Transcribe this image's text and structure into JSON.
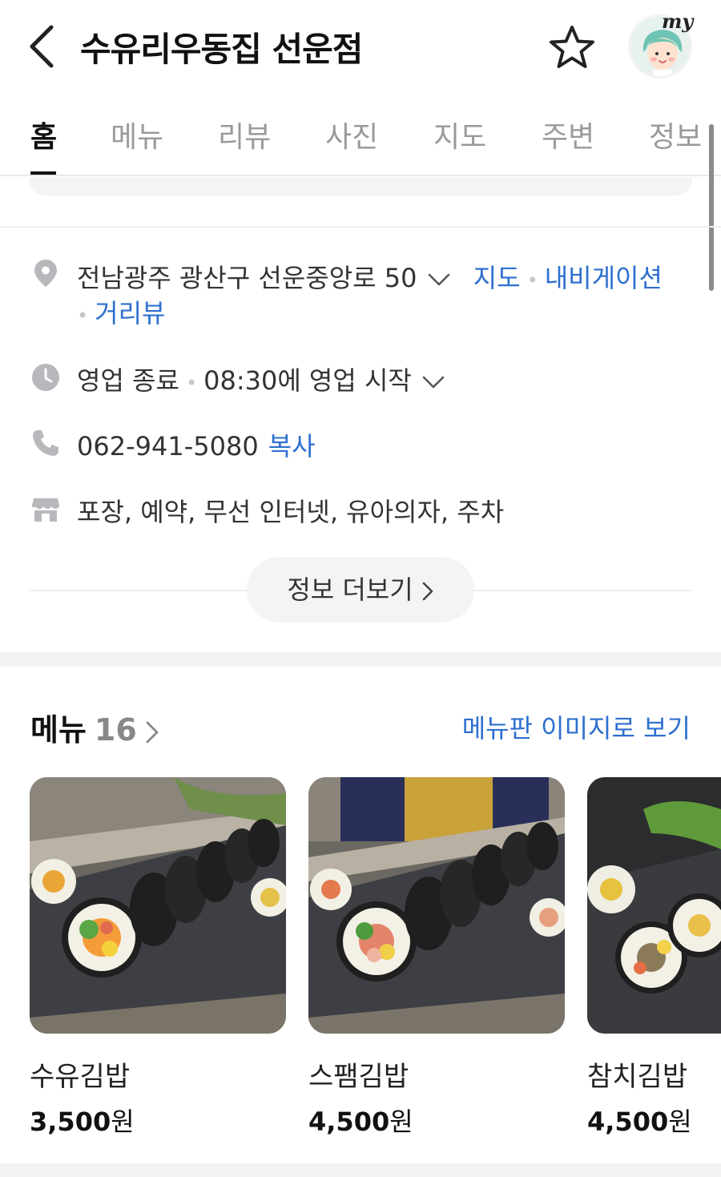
{
  "header": {
    "title": "수유리우동집 선운점",
    "avatar_badge": "my"
  },
  "tabs": [
    {
      "label": "홈",
      "active": true
    },
    {
      "label": "메뉴"
    },
    {
      "label": "리뷰"
    },
    {
      "label": "사진"
    },
    {
      "label": "지도"
    },
    {
      "label": "주변"
    },
    {
      "label": "정보"
    }
  ],
  "info": {
    "address": "전남광주 광산구 선운중앙로 50",
    "map_link": "지도",
    "navigation_link": "내비게이션",
    "streetview_link": "거리뷰",
    "hours_status": "영업 종료",
    "hours_next": "08:30에 영업 시작",
    "phone": "062-941-5080",
    "copy_link": "복사",
    "amenities": "포장, 예약, 무선 인터넷, 유아의자, 주차",
    "more_button": "정보 더보기"
  },
  "menu": {
    "heading": "메뉴",
    "count": "16",
    "image_view_link": "메뉴판 이미지로 보기",
    "items": [
      {
        "name": "수유김밥",
        "price": "3,500",
        "unit": "원"
      },
      {
        "name": "스팸김밥",
        "price": "4,500",
        "unit": "원"
      },
      {
        "name": "참치김밥",
        "price": "4,500",
        "unit": "원"
      }
    ]
  },
  "colors": {
    "link": "#2d6fcf",
    "icon_gray": "#b8b8bc",
    "divider": "#f2f2f4"
  }
}
